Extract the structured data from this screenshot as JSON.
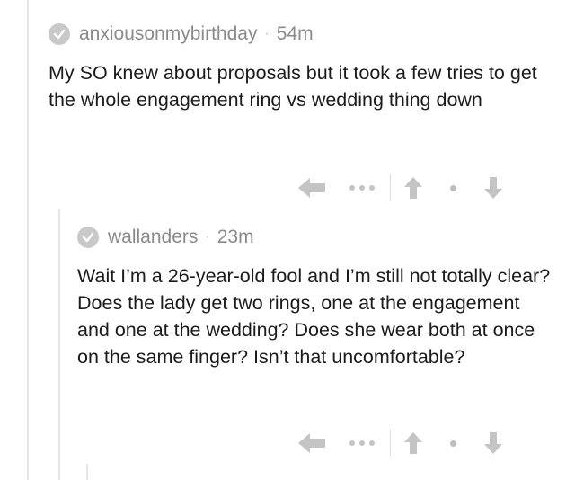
{
  "comments": [
    {
      "username": "anxiousonmybirthday",
      "separator": "·",
      "age": "54m",
      "text": "My SO knew about proposals but it took a few tries to get the whole engagement ring vs wedding thing down"
    },
    {
      "username": "wallanders",
      "separator": "·",
      "age": "23m",
      "text": "Wait I’m a 26-year-old fool and I’m still not totally clear? Does the lady get two rings, one at the engagement and one at the wedding? Does she wear both at once on the same finger? Isn’t that uncomfortable?"
    }
  ],
  "icons": {
    "badge": "check-badge-icon",
    "reply": "reply-arrow-icon",
    "more": "more-dots-icon",
    "upvote": "upvote-arrow-icon",
    "score": "score-dot",
    "downvote": "downvote-arrow-icon"
  },
  "colors": {
    "icon_gray": "#c4c4c4",
    "meta_gray": "#8a8a8a",
    "thread_line": "#e6e6e6"
  }
}
